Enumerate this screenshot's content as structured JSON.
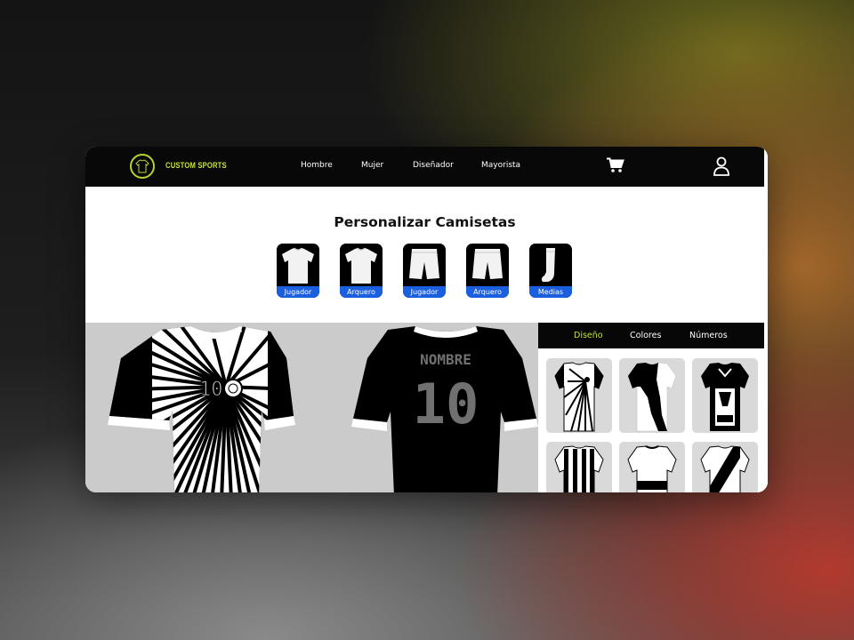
{
  "brand": {
    "name": "CUSTOM SPORTS",
    "accent": "#c9e23a"
  },
  "nav": {
    "links": [
      "Hombre",
      "Mujer",
      "Diseñador",
      "Mayorista"
    ],
    "icons": [
      "cart-icon",
      "user-icon"
    ]
  },
  "page": {
    "title": "Personalizar Camisetas"
  },
  "garments": [
    {
      "label": "Jugador",
      "icon": "tshirt-icon"
    },
    {
      "label": "Arquero",
      "icon": "tshirt-icon"
    },
    {
      "label": "Jugador",
      "icon": "shorts-icon"
    },
    {
      "label": "Arquero",
      "icon": "shorts-icon"
    },
    {
      "label": "Medias",
      "icon": "sock-icon"
    }
  ],
  "preview": {
    "back_name": "NOMBRE",
    "back_number": "10",
    "front_number": "10"
  },
  "panel": {
    "tabs": [
      "Diseño",
      "Colores",
      "Números"
    ],
    "active_tab": "Diseño",
    "designs": [
      "sunburst",
      "diagonal-split",
      "geometric",
      "vertical-stripes",
      "horizontal-band",
      "diagonal-sash"
    ]
  },
  "colors": {
    "label_bar": "#1a5fe0",
    "preview_bg": "#cbcbcb",
    "nav_bg": "#080808"
  }
}
